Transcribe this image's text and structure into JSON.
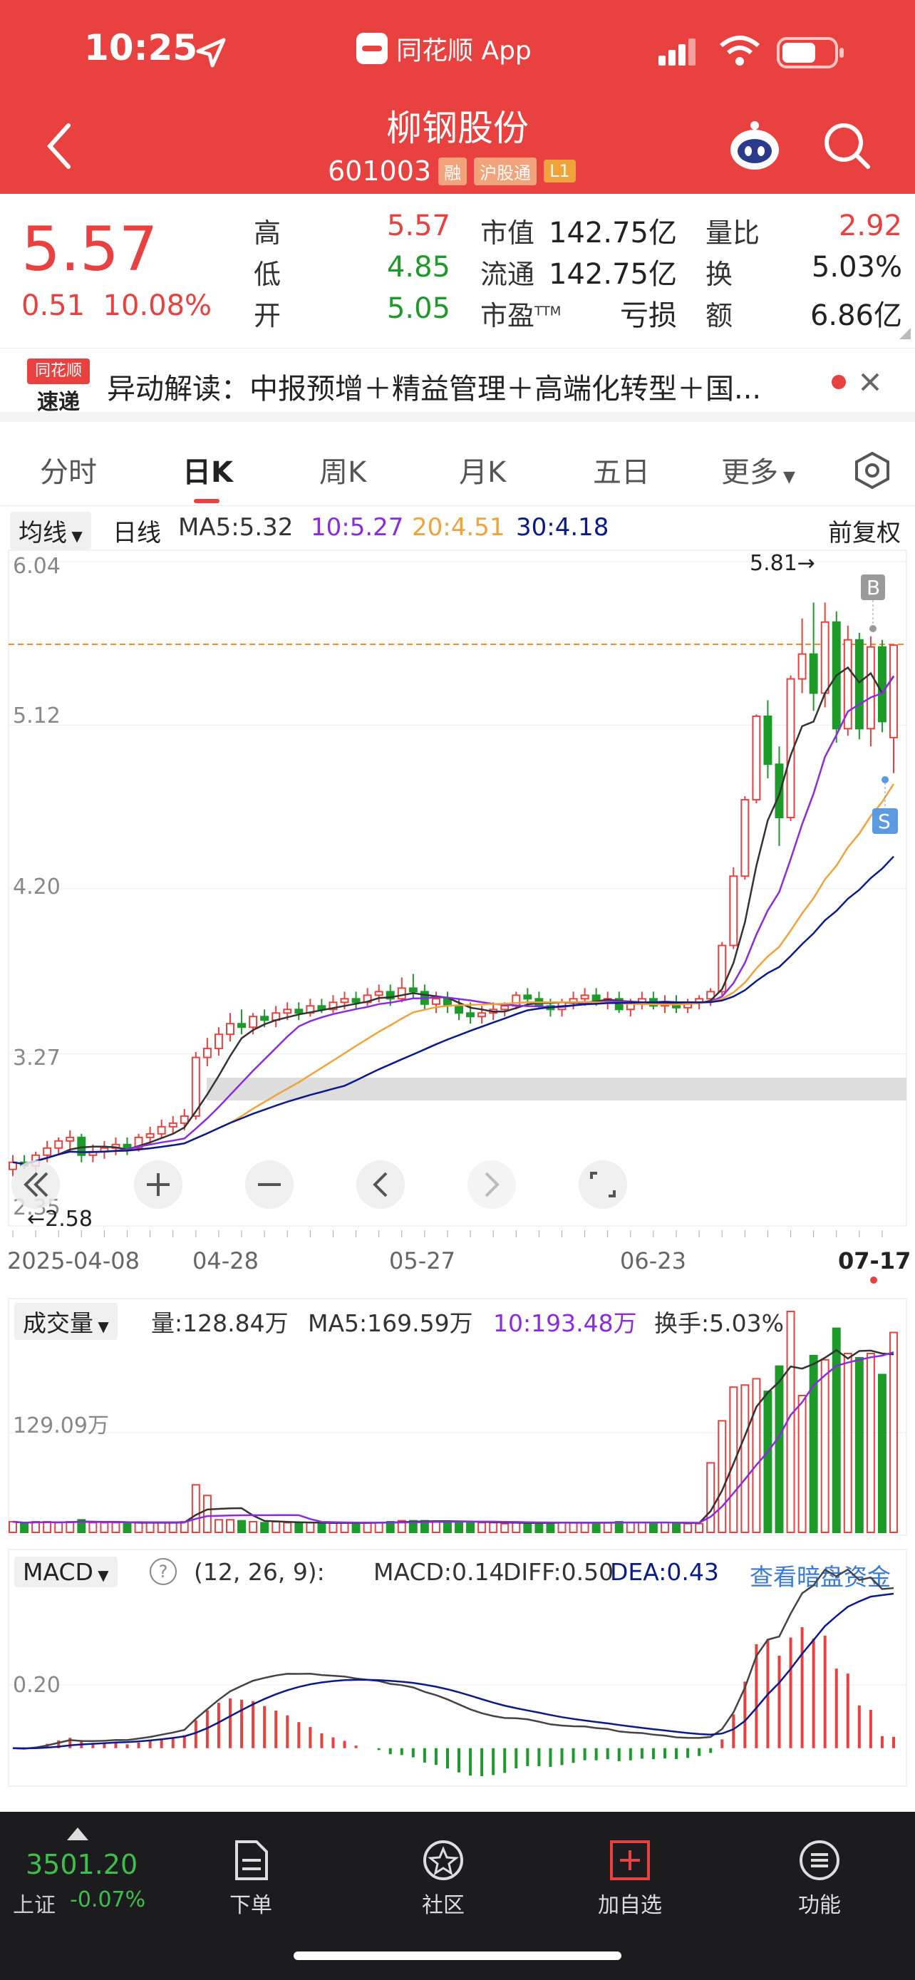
{
  "status": {
    "time": "10:25",
    "app": "同花顺 App"
  },
  "header": {
    "title": "柳钢股份",
    "code": "601003",
    "badges": [
      "融",
      "沪股通",
      "L1"
    ]
  },
  "quote": {
    "price": "5.57",
    "change": "0.51",
    "change_pct": "10.08%",
    "high_label": "高",
    "high": "5.57",
    "low_label": "低",
    "low": "4.85",
    "open_label": "开",
    "open": "5.05",
    "mcap_label": "市值",
    "mcap": "142.75亿",
    "float_label": "流通",
    "float": "142.75亿",
    "pe_label": "市盈",
    "pe_sup": "TTM",
    "pe": "亏损",
    "vr_label": "量比",
    "vr": "2.92",
    "turn_label": "换",
    "turn": "5.03%",
    "amt_label": "额",
    "amt": "6.86亿"
  },
  "news": {
    "logo_top": "同花顺",
    "logo_bottom": "速递",
    "text": "异动解读：中报预增＋精益管理＋高端化转型＋国..."
  },
  "tabs": [
    "分时",
    "日K",
    "周K",
    "月K",
    "五日",
    "更多"
  ],
  "ma": {
    "selector": "均线",
    "period": "日线",
    "ma5": "MA5:5.32",
    "ma10": "10:5.27",
    "ma20": "20:4.51",
    "ma30": "30:4.18",
    "adjust": "前复权"
  },
  "kline": {
    "y_labels": [
      "6.04",
      "5.12",
      "4.20",
      "3.27",
      "2.35"
    ],
    "high_mark": "5.81→",
    "low_mark": "←2.58",
    "dates": [
      "2025-04-08",
      "04-28",
      "05-27",
      "06-23",
      "07-17"
    ],
    "b_mark": "B",
    "s_mark": "S"
  },
  "volume": {
    "selector": "成交量",
    "vol": "量:128.84万",
    "ma5": "MA5:169.59万",
    "ma10": "10:193.48万",
    "turnover": "换手:5.03%",
    "y_label": "129.09万"
  },
  "macd": {
    "selector": "MACD",
    "params": "(12, 26, 9):",
    "macd": "MACD:0.14",
    "diff": "DIFF:0.50",
    "dea": "DEA:0.43",
    "link": "查看暗盘资金",
    "y_label": "0.20"
  },
  "toolbar": {
    "index_value": "3501.20",
    "index_name": "上证",
    "index_change": "-0.07%",
    "items": [
      "下单",
      "社区",
      "加自选",
      "功能"
    ]
  },
  "colors": {
    "up": "#e8413f",
    "down": "#1e9a2b",
    "ma5": "#333333",
    "ma10": "#8a2be2",
    "ma20": "#f0a33a",
    "ma30": "#0b1a8a"
  },
  "chart_data": {
    "type": "candlestick",
    "x_start": "2025-04-08",
    "x_end": "2025-07-17",
    "ohlc": [
      [
        2.62,
        2.7,
        2.58,
        2.66
      ],
      [
        2.66,
        2.7,
        2.62,
        2.64
      ],
      [
        2.64,
        2.72,
        2.6,
        2.7
      ],
      [
        2.7,
        2.78,
        2.66,
        2.74
      ],
      [
        2.74,
        2.8,
        2.7,
        2.78
      ],
      [
        2.78,
        2.84,
        2.72,
        2.8
      ],
      [
        2.8,
        2.82,
        2.66,
        2.7
      ],
      [
        2.7,
        2.76,
        2.66,
        2.72
      ],
      [
        2.72,
        2.78,
        2.68,
        2.74
      ],
      [
        2.74,
        2.8,
        2.7,
        2.76
      ],
      [
        2.76,
        2.8,
        2.7,
        2.74
      ],
      [
        2.74,
        2.82,
        2.72,
        2.8
      ],
      [
        2.8,
        2.86,
        2.76,
        2.82
      ],
      [
        2.82,
        2.9,
        2.8,
        2.86
      ],
      [
        2.86,
        2.92,
        2.82,
        2.88
      ],
      [
        2.88,
        2.96,
        2.84,
        2.92
      ],
      [
        2.92,
        3.28,
        2.9,
        3.25
      ],
      [
        3.25,
        3.36,
        3.2,
        3.3
      ],
      [
        3.3,
        3.42,
        3.26,
        3.38
      ],
      [
        3.38,
        3.5,
        3.34,
        3.44
      ],
      [
        3.44,
        3.52,
        3.38,
        3.42
      ],
      [
        3.42,
        3.5,
        3.38,
        3.48
      ],
      [
        3.48,
        3.52,
        3.42,
        3.46
      ],
      [
        3.46,
        3.54,
        3.42,
        3.5
      ],
      [
        3.5,
        3.56,
        3.46,
        3.52
      ],
      [
        3.52,
        3.56,
        3.46,
        3.5
      ],
      [
        3.5,
        3.58,
        3.48,
        3.54
      ],
      [
        3.54,
        3.58,
        3.5,
        3.52
      ],
      [
        3.52,
        3.6,
        3.5,
        3.56
      ],
      [
        3.56,
        3.62,
        3.52,
        3.58
      ],
      [
        3.58,
        3.62,
        3.52,
        3.56
      ],
      [
        3.56,
        3.64,
        3.54,
        3.6
      ],
      [
        3.6,
        3.66,
        3.56,
        3.62
      ],
      [
        3.62,
        3.66,
        3.54,
        3.58
      ],
      [
        3.58,
        3.7,
        3.56,
        3.64
      ],
      [
        3.64,
        3.72,
        3.58,
        3.62
      ],
      [
        3.62,
        3.66,
        3.52,
        3.55
      ],
      [
        3.55,
        3.62,
        3.5,
        3.58
      ],
      [
        3.58,
        3.62,
        3.5,
        3.54
      ],
      [
        3.54,
        3.58,
        3.46,
        3.5
      ],
      [
        3.5,
        3.56,
        3.44,
        3.48
      ],
      [
        3.48,
        3.54,
        3.44,
        3.5
      ],
      [
        3.5,
        3.56,
        3.46,
        3.52
      ],
      [
        3.52,
        3.56,
        3.48,
        3.54
      ],
      [
        3.54,
        3.62,
        3.52,
        3.6
      ],
      [
        3.6,
        3.64,
        3.54,
        3.58
      ],
      [
        3.58,
        3.62,
        3.52,
        3.54
      ],
      [
        3.54,
        3.58,
        3.48,
        3.52
      ],
      [
        3.52,
        3.58,
        3.48,
        3.56
      ],
      [
        3.56,
        3.62,
        3.52,
        3.58
      ],
      [
        3.58,
        3.64,
        3.54,
        3.6
      ],
      [
        3.6,
        3.64,
        3.54,
        3.56
      ],
      [
        3.56,
        3.62,
        3.52,
        3.58
      ],
      [
        3.58,
        3.62,
        3.5,
        3.52
      ],
      [
        3.52,
        3.58,
        3.48,
        3.56
      ],
      [
        3.56,
        3.62,
        3.52,
        3.58
      ],
      [
        3.58,
        3.62,
        3.52,
        3.54
      ],
      [
        3.54,
        3.6,
        3.5,
        3.56
      ],
      [
        3.56,
        3.6,
        3.5,
        3.53
      ],
      [
        3.53,
        3.58,
        3.5,
        3.56
      ],
      [
        3.56,
        3.6,
        3.52,
        3.58
      ],
      [
        3.58,
        3.64,
        3.54,
        3.62
      ],
      [
        3.62,
        3.9,
        3.6,
        3.88
      ],
      [
        3.88,
        4.32,
        3.86,
        4.27
      ],
      [
        4.27,
        4.72,
        4.25,
        4.7
      ],
      [
        4.7,
        5.18,
        4.68,
        5.17
      ],
      [
        5.17,
        5.26,
        4.82,
        4.9
      ],
      [
        4.9,
        5.0,
        4.44,
        4.6
      ],
      [
        4.6,
        5.4,
        4.58,
        5.38
      ],
      [
        5.38,
        5.72,
        5.3,
        5.52
      ],
      [
        5.52,
        5.81,
        5.2,
        5.3
      ],
      [
        5.3,
        5.81,
        5.22,
        5.7
      ],
      [
        5.7,
        5.76,
        5.02,
        5.1
      ],
      [
        5.1,
        5.68,
        5.06,
        5.6
      ],
      [
        5.6,
        5.64,
        5.04,
        5.1
      ],
      [
        5.1,
        5.62,
        5.0,
        5.56
      ],
      [
        5.56,
        5.6,
        5.08,
        5.14
      ],
      [
        5.05,
        5.57,
        4.85,
        5.57
      ]
    ],
    "volume_unit": "万"
  }
}
